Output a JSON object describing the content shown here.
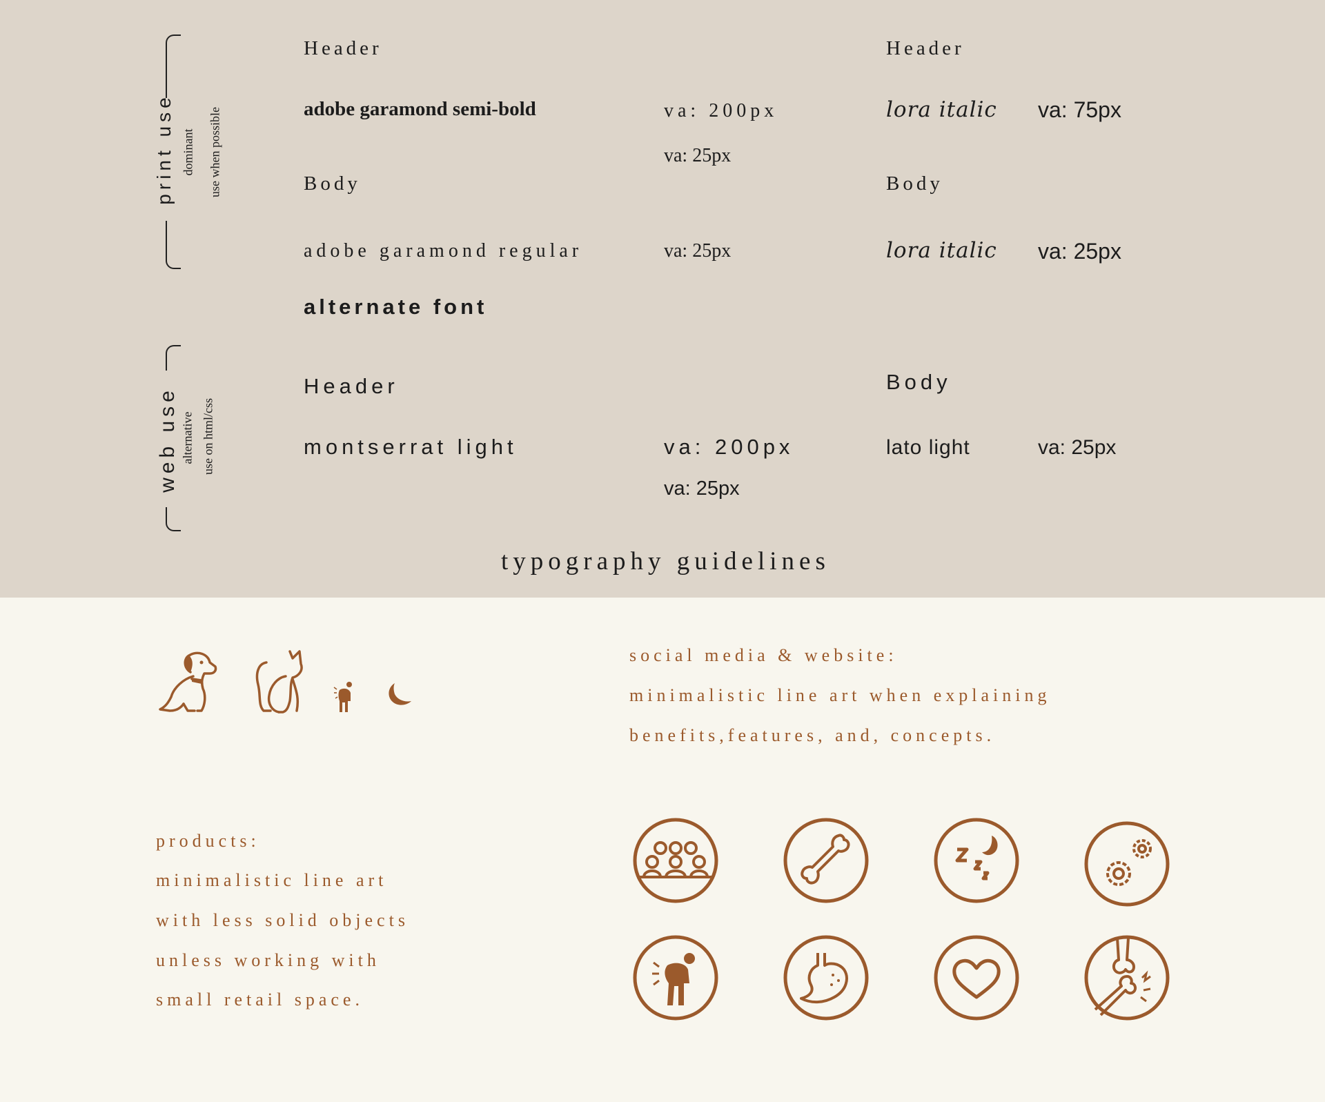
{
  "print_section": {
    "side_title": "print use",
    "side_sub1": "dominant",
    "side_sub2": "use when possible",
    "left_header": "Header",
    "left_header_font": "adobe garamond semi-bold",
    "left_header_va": "va: 200px",
    "left_header_va2": "va: 25px",
    "left_body": "Body",
    "left_body_font": "adobe garamond regular",
    "left_body_va": "va: 25px",
    "right_header": "Header",
    "right_header_font": "lora italic",
    "right_header_va": "va: 75px",
    "right_body": "Body",
    "right_body_font": "lora italic",
    "right_body_va": "va: 25px"
  },
  "alternate_font_label": "alternate font",
  "web_section": {
    "side_title": "web use",
    "side_sub1": "alternative",
    "side_sub2": "use on html/css",
    "left_header": "Header",
    "left_header_font": "montserrat light",
    "left_header_va": "va: 200px",
    "left_header_va2": "va: 25px",
    "right_body": "Body",
    "right_body_font": "lato light",
    "right_body_va": "va: 25px"
  },
  "page_title": "typography guidelines",
  "social": {
    "line1": "social media & website:",
    "line2": "minimalistic line art when explaining",
    "line3": "benefits,features, and, concepts."
  },
  "products": {
    "line1": "products:",
    "line2": "minimalistic line art",
    "line3": "with less solid objects",
    "line4": "unless working with",
    "line5": "small retail space."
  },
  "colors": {
    "top_background": "#ddd5ca",
    "bottom_background": "#f8f6ee",
    "accent_brown": "#9b5a2c",
    "text_dark": "#1c1c1c"
  },
  "icons": {
    "small": [
      "dog-icon",
      "cat-icon",
      "back-pain-person-icon",
      "moon-icon"
    ],
    "circles": [
      "group-people-icon",
      "bone-icon",
      "sleep-icon",
      "gears-icon",
      "back-pain-icon",
      "stomach-icon",
      "heart-icon",
      "joint-pain-icon"
    ]
  }
}
